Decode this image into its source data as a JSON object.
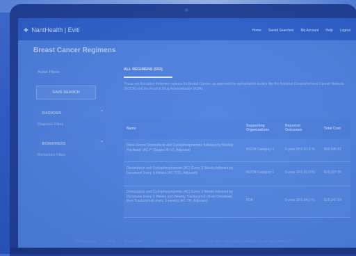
{
  "app": {
    "logo_text": "NantHealth | Eviti",
    "nav": [
      "Home",
      "Saved Searches",
      "My Account",
      "Help",
      "Logout"
    ]
  },
  "page_title": "Breast Cancer Regimens",
  "sidebar": {
    "active_filters_label": "Active Filters",
    "save_search_label": "SAVE SEARCH",
    "sections": [
      {
        "label": "DIAGNOSIS",
        "sub": "Diagnosis Filters"
      },
      {
        "label": "BIOMARKERS",
        "sub": "Biomarkers Filters"
      }
    ]
  },
  "tab": {
    "label": "ALL REGIMENS (553)"
  },
  "description": "These are the latest treatment options for Breast Cancer, as approved by authoritative bodies like the National Comprehensive Cancer Network (NCCN) and the Food & Drug Administration (FDA).",
  "table": {
    "columns": [
      "Name",
      "Supporting Organizations",
      "Reported Outcomes",
      "Total Cost"
    ],
    "rows": [
      {
        "name": "Dose-Dense Doxorubicin and Cyclophosphamide followed by Weekly Paclitaxel (AC-P (Stages III-IV), Adjuvant)",
        "org": "NCCN Category 1",
        "outcome": "5-year DFS 81.5 %",
        "cost": "$16,645.02"
      },
      {
        "name": "Doxorubicin and Cyclophosphamide (AC) Every 3 Weeks followed by Docetaxel Every 3 Weeks (AC-T(D), Adjuvant)",
        "org": "NCCN Category 1",
        "outcome": "5-year DFS 81.0 %",
        "cost": "$16,027.25"
      },
      {
        "name": "Doxorubicin and Cyclophosphamide (AC) Every 3 Weeks followed by Docetaxel Every 3 Weeks and Weekly Trastuzumab (from Docetaxel, then Trastuzumab every 3 weeks) (AC-TH, Adjuvant)",
        "org": "FDA",
        "outcome": "5-year DFS 84.0 %",
        "cost": "$16,247.09"
      }
    ]
  },
  "footer": [
    "Privacy Policy",
    "FAQ",
    "Terms of Use",
    "Do Not Sell My Information",
    "Copyright © 2020-2022 NantHealth, Inc. All Rights Reserved."
  ]
}
